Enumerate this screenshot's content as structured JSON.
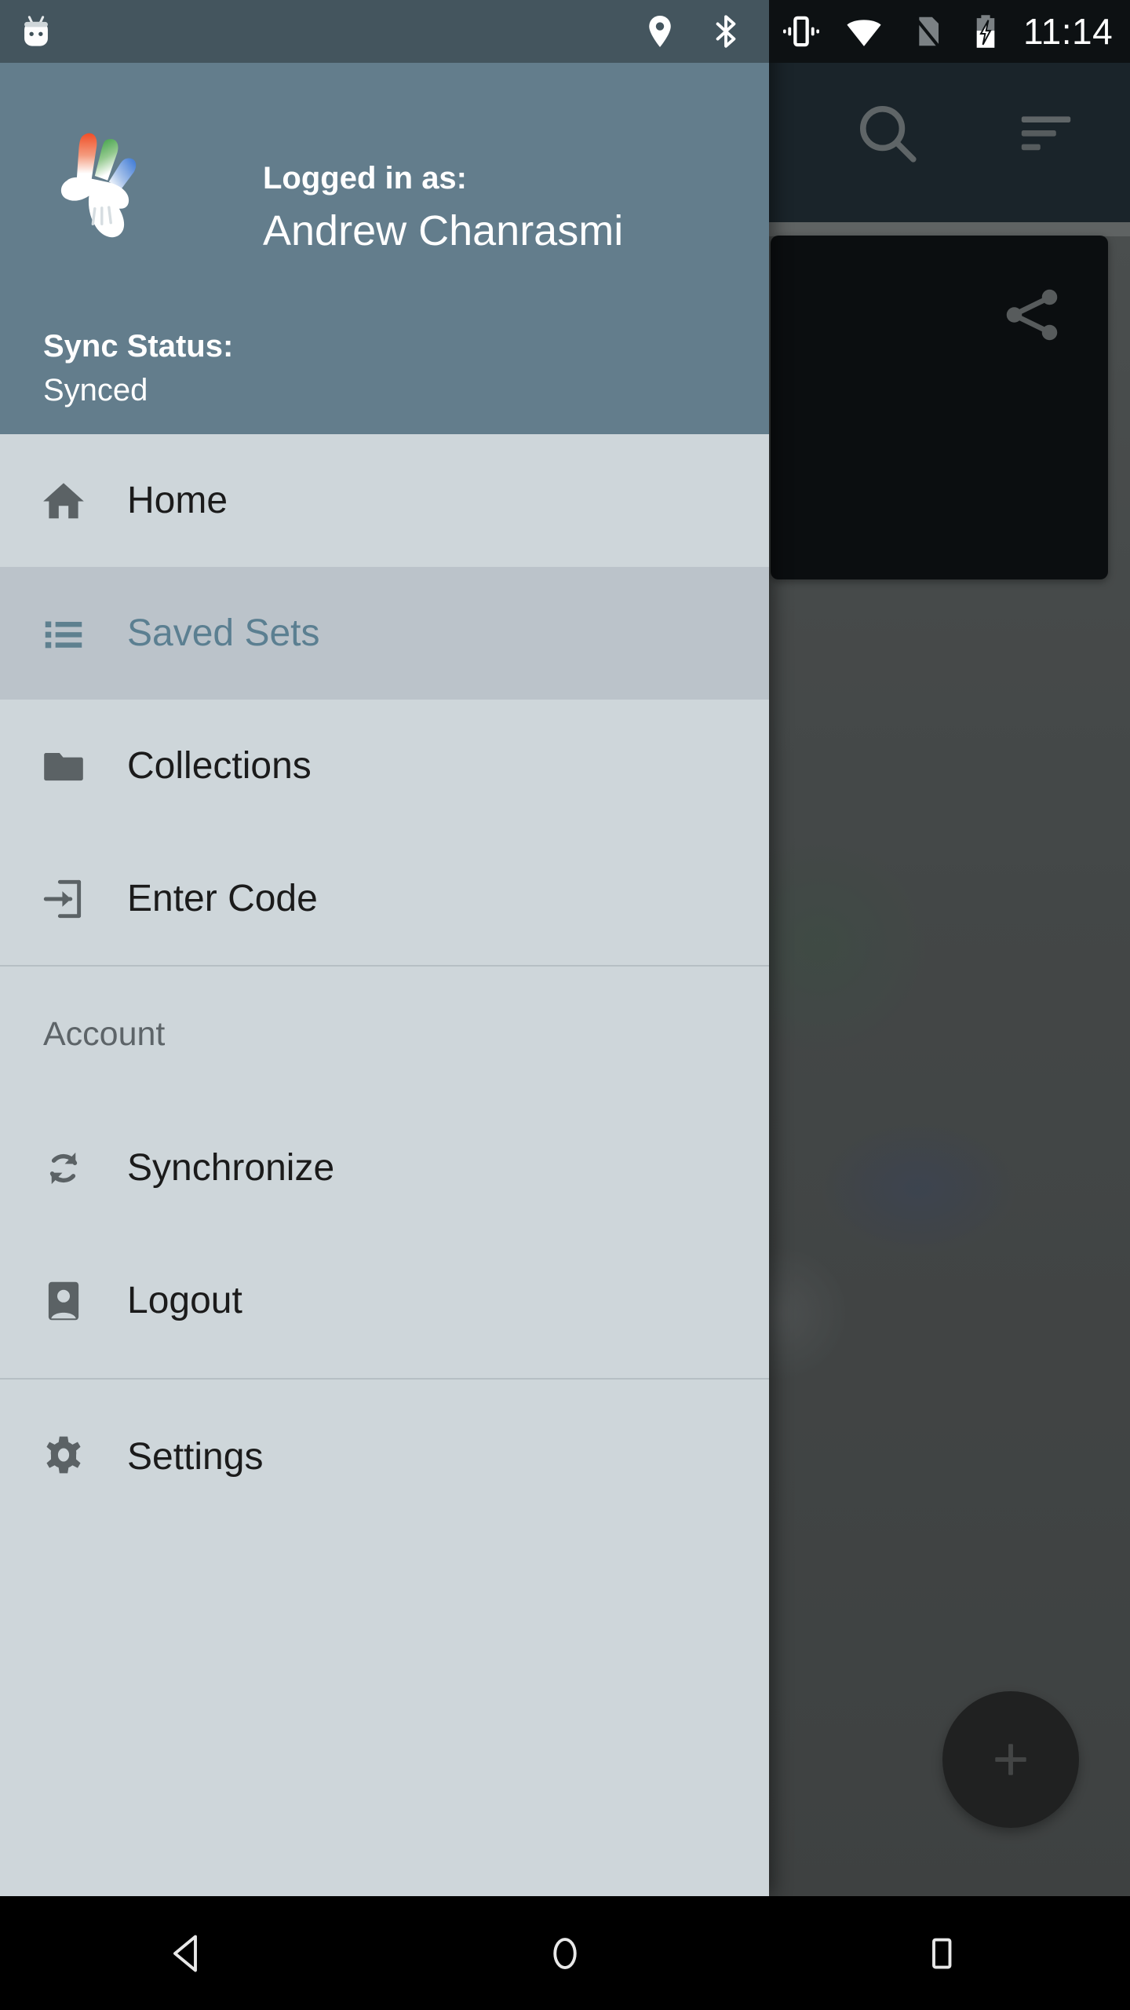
{
  "status_bar": {
    "app_icon": "android-mascot-icon",
    "icons": [
      "location-icon",
      "bluetooth-icon",
      "vibrate-icon",
      "wifi-icon",
      "no-sim-icon",
      "battery-charging-icon"
    ],
    "clock": "11:14"
  },
  "app_bar": {
    "search_label": "search-icon",
    "sort_label": "sort-icon"
  },
  "content": {
    "card_share_label": "share-icon",
    "fab_label": "+"
  },
  "drawer": {
    "header": {
      "logo": "hand-logo",
      "logged_in_label": "Logged in as:",
      "user_name": "Andrew Chanrasmi",
      "sync_status_label": "Sync Status:",
      "sync_status_value": "Synced"
    },
    "primary_items": [
      {
        "id": "home",
        "label": "Home",
        "icon": "home-icon",
        "selected": false
      },
      {
        "id": "saved-sets",
        "label": "Saved Sets",
        "icon": "list-icon",
        "selected": true
      },
      {
        "id": "collections",
        "label": "Collections",
        "icon": "folder-icon",
        "selected": false
      },
      {
        "id": "enter-code",
        "label": "Enter Code",
        "icon": "input-arrow-icon",
        "selected": false
      }
    ],
    "account_section": {
      "title": "Account",
      "items": [
        {
          "id": "synchronize",
          "label": "Synchronize",
          "icon": "sync-icon",
          "selected": false
        },
        {
          "id": "logout",
          "label": "Logout",
          "icon": "account-box-icon",
          "selected": false
        }
      ]
    },
    "footer_items": [
      {
        "id": "settings",
        "label": "Settings",
        "icon": "gear-icon",
        "selected": false
      }
    ]
  },
  "nav_bar": {
    "back_label": "back-icon",
    "home_label": "home-circle-icon",
    "recents_label": "recents-square-icon"
  },
  "colors": {
    "drawer_background": "#ced6da",
    "drawer_header": "#637d8c",
    "selected_row": "#bbc3ca",
    "selected_text": "#5b7f91",
    "app_bar": "#2b3b44",
    "card": "#12181b"
  }
}
